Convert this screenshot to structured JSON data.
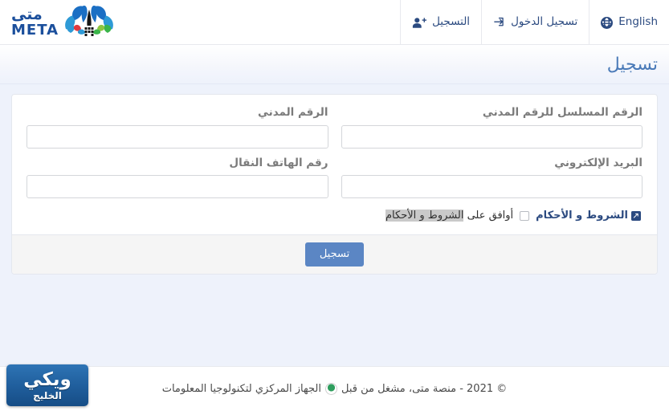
{
  "brand": {
    "arabic": "متى",
    "english": "META",
    "logo_colors": [
      "#1b6fc4",
      "#2e9ad6",
      "#3ab54a",
      "#8cc63f",
      "#e03a3e",
      "#1b4f9c"
    ]
  },
  "topnav": {
    "items": [
      {
        "id": "register",
        "label": "التسجيل",
        "icon": "user-plus-icon"
      },
      {
        "id": "login",
        "label": "تسجيل الدخول",
        "icon": "sign-in-icon"
      },
      {
        "id": "language",
        "label": "English",
        "icon": "globe-icon"
      }
    ]
  },
  "page": {
    "title": "تسجيل",
    "title_color": "#4a7ab8"
  },
  "form": {
    "rows": [
      {
        "right": {
          "id": "civil-number",
          "label": "الرقم المدني",
          "value": "",
          "placeholder": ""
        },
        "left": {
          "id": "civil-serial-number",
          "label": "الرقم المسلسل للرقم المدني",
          "value": "",
          "placeholder": ""
        }
      },
      {
        "right": {
          "id": "mobile-phone",
          "label": "رقم الهاتف النقال",
          "value": "",
          "placeholder": ""
        },
        "left": {
          "id": "email",
          "label": "البريد الإلكتروني",
          "value": "",
          "placeholder": ""
        }
      }
    ],
    "terms": {
      "link_label": "الشروط و الأحكام",
      "link_icon": "external-link-icon",
      "checkbox_checked": false,
      "agree_prefix": "أوافق على ",
      "agree_highlighted": "الشروط و الأحكام"
    },
    "submit": {
      "label": "تسجيل",
      "color": "#5b86c4"
    }
  },
  "footer": {
    "text_before": "© 2021 - منصة متى، مشغل من قبل",
    "emblem": "kuwait-gov-emblem-icon",
    "text_after": "الجهاز المركزي لتكنولوجيا المعلومات"
  },
  "watermark": {
    "top": "ويكي",
    "bottom": "الخليج",
    "color": "#1f5d9b"
  }
}
